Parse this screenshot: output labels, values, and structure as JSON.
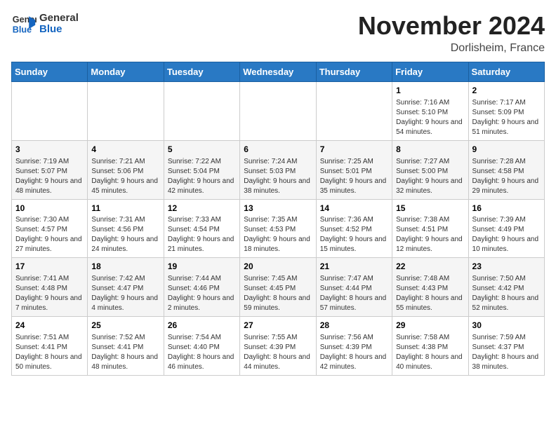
{
  "logo": {
    "line1": "General",
    "line2": "Blue"
  },
  "title": "November 2024",
  "location": "Dorlisheim, France",
  "days_header": [
    "Sunday",
    "Monday",
    "Tuesday",
    "Wednesday",
    "Thursday",
    "Friday",
    "Saturday"
  ],
  "weeks": [
    [
      {
        "day": "",
        "detail": ""
      },
      {
        "day": "",
        "detail": ""
      },
      {
        "day": "",
        "detail": ""
      },
      {
        "day": "",
        "detail": ""
      },
      {
        "day": "",
        "detail": ""
      },
      {
        "day": "1",
        "detail": "Sunrise: 7:16 AM\nSunset: 5:10 PM\nDaylight: 9 hours and 54 minutes."
      },
      {
        "day": "2",
        "detail": "Sunrise: 7:17 AM\nSunset: 5:09 PM\nDaylight: 9 hours and 51 minutes."
      }
    ],
    [
      {
        "day": "3",
        "detail": "Sunrise: 7:19 AM\nSunset: 5:07 PM\nDaylight: 9 hours and 48 minutes."
      },
      {
        "day": "4",
        "detail": "Sunrise: 7:21 AM\nSunset: 5:06 PM\nDaylight: 9 hours and 45 minutes."
      },
      {
        "day": "5",
        "detail": "Sunrise: 7:22 AM\nSunset: 5:04 PM\nDaylight: 9 hours and 42 minutes."
      },
      {
        "day": "6",
        "detail": "Sunrise: 7:24 AM\nSunset: 5:03 PM\nDaylight: 9 hours and 38 minutes."
      },
      {
        "day": "7",
        "detail": "Sunrise: 7:25 AM\nSunset: 5:01 PM\nDaylight: 9 hours and 35 minutes."
      },
      {
        "day": "8",
        "detail": "Sunrise: 7:27 AM\nSunset: 5:00 PM\nDaylight: 9 hours and 32 minutes."
      },
      {
        "day": "9",
        "detail": "Sunrise: 7:28 AM\nSunset: 4:58 PM\nDaylight: 9 hours and 29 minutes."
      }
    ],
    [
      {
        "day": "10",
        "detail": "Sunrise: 7:30 AM\nSunset: 4:57 PM\nDaylight: 9 hours and 27 minutes."
      },
      {
        "day": "11",
        "detail": "Sunrise: 7:31 AM\nSunset: 4:56 PM\nDaylight: 9 hours and 24 minutes."
      },
      {
        "day": "12",
        "detail": "Sunrise: 7:33 AM\nSunset: 4:54 PM\nDaylight: 9 hours and 21 minutes."
      },
      {
        "day": "13",
        "detail": "Sunrise: 7:35 AM\nSunset: 4:53 PM\nDaylight: 9 hours and 18 minutes."
      },
      {
        "day": "14",
        "detail": "Sunrise: 7:36 AM\nSunset: 4:52 PM\nDaylight: 9 hours and 15 minutes."
      },
      {
        "day": "15",
        "detail": "Sunrise: 7:38 AM\nSunset: 4:51 PM\nDaylight: 9 hours and 12 minutes."
      },
      {
        "day": "16",
        "detail": "Sunrise: 7:39 AM\nSunset: 4:49 PM\nDaylight: 9 hours and 10 minutes."
      }
    ],
    [
      {
        "day": "17",
        "detail": "Sunrise: 7:41 AM\nSunset: 4:48 PM\nDaylight: 9 hours and 7 minutes."
      },
      {
        "day": "18",
        "detail": "Sunrise: 7:42 AM\nSunset: 4:47 PM\nDaylight: 9 hours and 4 minutes."
      },
      {
        "day": "19",
        "detail": "Sunrise: 7:44 AM\nSunset: 4:46 PM\nDaylight: 9 hours and 2 minutes."
      },
      {
        "day": "20",
        "detail": "Sunrise: 7:45 AM\nSunset: 4:45 PM\nDaylight: 8 hours and 59 minutes."
      },
      {
        "day": "21",
        "detail": "Sunrise: 7:47 AM\nSunset: 4:44 PM\nDaylight: 8 hours and 57 minutes."
      },
      {
        "day": "22",
        "detail": "Sunrise: 7:48 AM\nSunset: 4:43 PM\nDaylight: 8 hours and 55 minutes."
      },
      {
        "day": "23",
        "detail": "Sunrise: 7:50 AM\nSunset: 4:42 PM\nDaylight: 8 hours and 52 minutes."
      }
    ],
    [
      {
        "day": "24",
        "detail": "Sunrise: 7:51 AM\nSunset: 4:41 PM\nDaylight: 8 hours and 50 minutes."
      },
      {
        "day": "25",
        "detail": "Sunrise: 7:52 AM\nSunset: 4:41 PM\nDaylight: 8 hours and 48 minutes."
      },
      {
        "day": "26",
        "detail": "Sunrise: 7:54 AM\nSunset: 4:40 PM\nDaylight: 8 hours and 46 minutes."
      },
      {
        "day": "27",
        "detail": "Sunrise: 7:55 AM\nSunset: 4:39 PM\nDaylight: 8 hours and 44 minutes."
      },
      {
        "day": "28",
        "detail": "Sunrise: 7:56 AM\nSunset: 4:39 PM\nDaylight: 8 hours and 42 minutes."
      },
      {
        "day": "29",
        "detail": "Sunrise: 7:58 AM\nSunset: 4:38 PM\nDaylight: 8 hours and 40 minutes."
      },
      {
        "day": "30",
        "detail": "Sunrise: 7:59 AM\nSunset: 4:37 PM\nDaylight: 8 hours and 38 minutes."
      }
    ]
  ]
}
